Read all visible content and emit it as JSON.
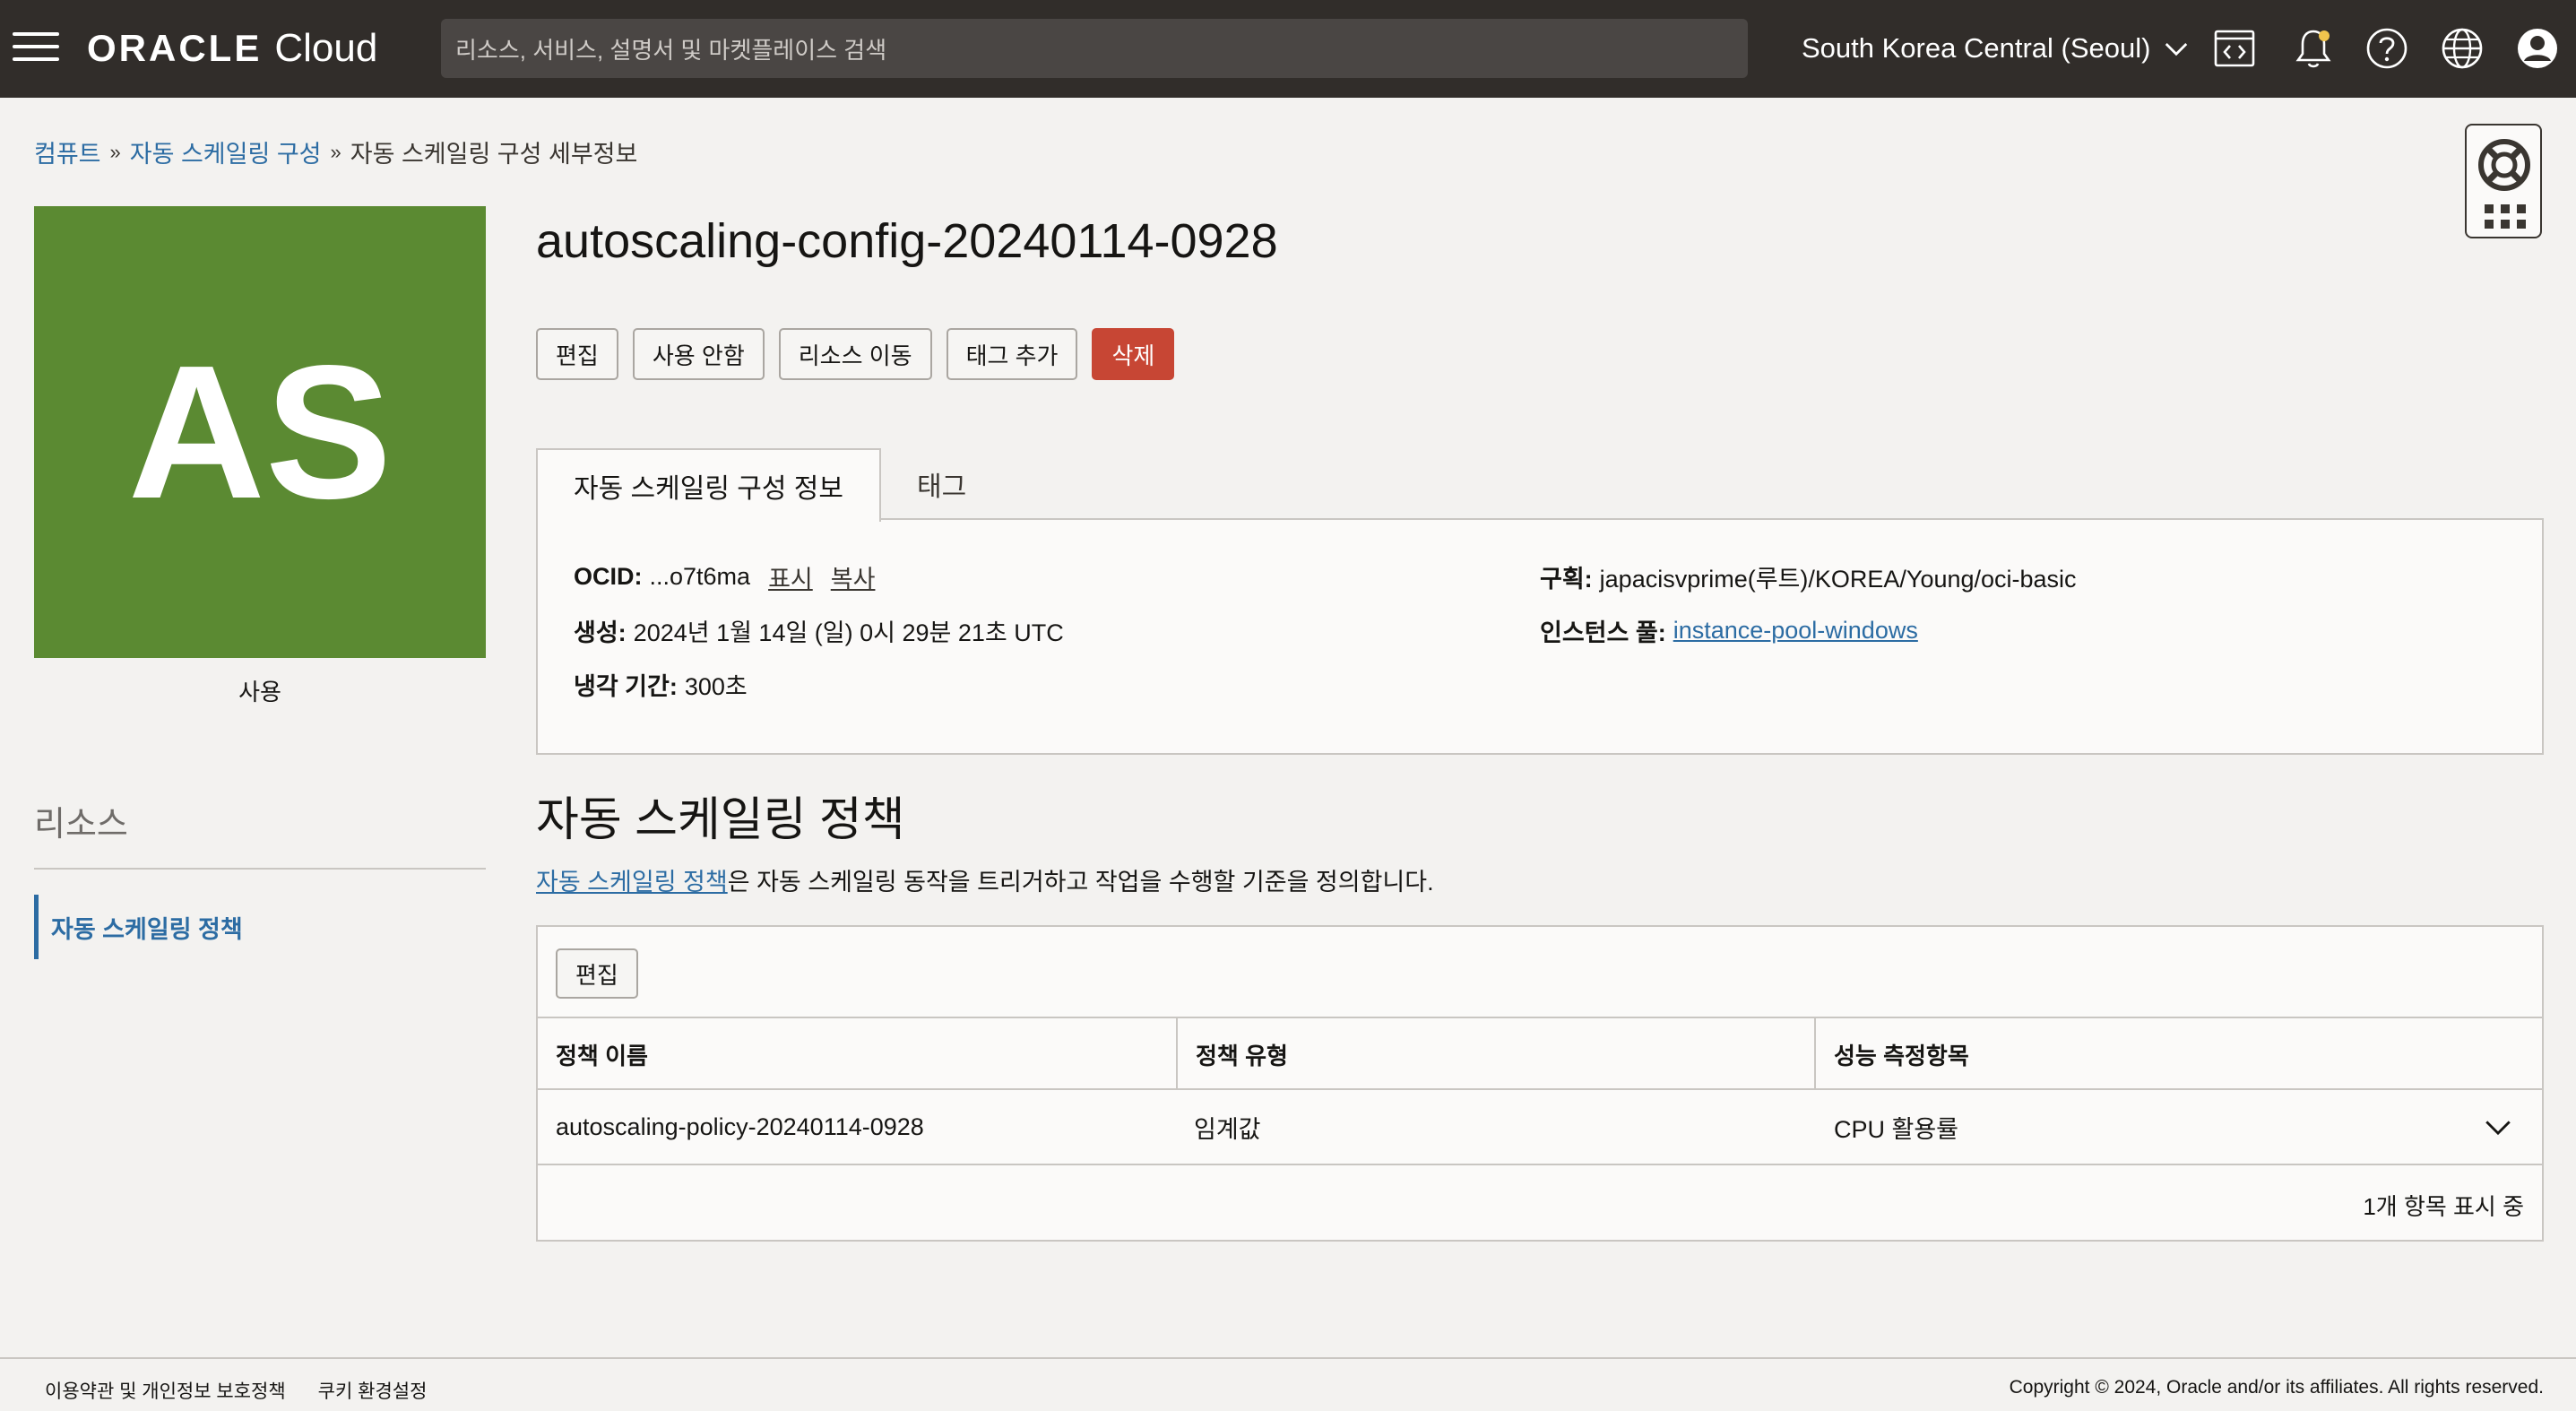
{
  "topbar": {
    "logo_brand": "ORACLE",
    "logo_product": "Cloud",
    "search_placeholder": "리소스, 서비스, 설명서 및 마켓플레이스 검색",
    "region": "South Korea Central (Seoul)",
    "icons": [
      "menu-icon",
      "developer-tools-icon",
      "notification-bell-icon",
      "help-icon",
      "language-globe-icon",
      "user-profile-icon"
    ]
  },
  "breadcrumb": {
    "items": [
      "컴퓨트",
      "자동 스케일링 구성",
      "자동 스케일링 구성 세부정보"
    ],
    "separator": "»"
  },
  "avatar": {
    "initials": "AS",
    "status": "사용",
    "color": "#5b8a32"
  },
  "page": {
    "title": "autoscaling-config-20240114-0928"
  },
  "actions": {
    "edit": "편집",
    "disable": "사용 안함",
    "move_resource": "리소스 이동",
    "add_tags": "태그 추가",
    "delete": "삭제",
    "delete_color": "#c74634"
  },
  "tabs": {
    "info": "자동 스케일링 구성 정보",
    "tags": "태그"
  },
  "info": {
    "ocid_label": "OCID:",
    "ocid_value": "...o7t6ma",
    "ocid_show": "표시",
    "ocid_copy": "복사",
    "created_label": "생성:",
    "created_value": "2024년 1월 14일 (일) 0시 29분 21초 UTC",
    "cooldown_label": "냉각 기간:",
    "cooldown_value": "300초",
    "compartment_label": "구획:",
    "compartment_value": "japacisvprime(루트)/KOREA/Young/oci-basic",
    "pool_label": "인스턴스 풀:",
    "pool_value": "instance-pool-windows"
  },
  "policies": {
    "title": "자동 스케일링 정책",
    "desc_link": "자동 스케일링 정책",
    "desc_rest": "은 자동 스케일링 동작을 트리거하고 작업을 수행할 기준을 정의합니다.",
    "edit": "편집",
    "columns": [
      "정책 이름",
      "정책 유형",
      "성능 측정항목"
    ],
    "rows": [
      [
        "autoscaling-policy-20240114-0928",
        "임계값",
        "CPU 활용률"
      ]
    ],
    "footer": "1개 항목 표시 중"
  },
  "sidebar": {
    "resources_title": "리소스",
    "items": [
      "자동 스케일링 정책"
    ]
  },
  "footer": {
    "terms": "이용약관 및 개인정보 보호정책",
    "cookies": "쿠키 환경설정",
    "copyright": "Copyright © 2024, Oracle and/or its affiliates. All rights reserved."
  },
  "colors": {
    "topbar": "#312d2a",
    "link": "#2c6ca3",
    "background": "#f3f2f0"
  }
}
